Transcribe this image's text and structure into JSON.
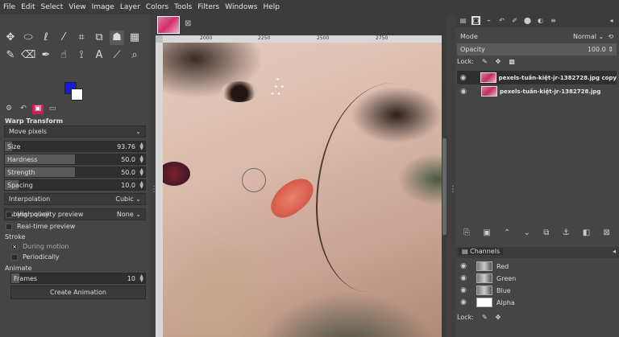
{
  "menu": [
    "File",
    "Edit",
    "Select",
    "View",
    "Image",
    "Layer",
    "Colors",
    "Tools",
    "Filters",
    "Windows",
    "Help"
  ],
  "tool_options": {
    "title": "Warp Transform",
    "behavior": "Move pixels",
    "sliders": [
      {
        "label": "Size",
        "value": "93.76",
        "fraction": 0.05
      },
      {
        "label": "Hardness",
        "value": "50.0",
        "fraction": 0.5
      },
      {
        "label": "Strength",
        "value": "50.0",
        "fraction": 0.5
      },
      {
        "label": "Spacing",
        "value": "10.0",
        "fraction": 0.1
      }
    ],
    "interpolation_label": "Interpolation",
    "interpolation_value": "Cubic",
    "abyss_label": "Abyss policy",
    "abyss_value": "None",
    "high_quality": "High quality preview",
    "realtime": "Real-time preview",
    "stroke_label": "Stroke",
    "during_motion": "During motion",
    "periodically": "Periodically",
    "animate_label": "Animate",
    "frames_label": "Frames",
    "frames_value": "10",
    "create_animation": "Create Animation"
  },
  "ruler": {
    "t1": "2000",
    "t2": "2250",
    "t3": "2500",
    "t4": "2750"
  },
  "layers_panel": {
    "mode_label": "Mode",
    "mode_value": "Normal",
    "opacity_label": "Opacity",
    "opacity_value": "100.0",
    "lock_label": "Lock:",
    "layers": [
      {
        "name": "pexels-tuấn-kiệt-jr-1382728.jpg copy"
      },
      {
        "name": "pexels-tuấn-kiệt-jr-1382728.jpg"
      }
    ]
  },
  "channels_panel": {
    "tab": "Channels",
    "channels": [
      "Red",
      "Green",
      "Blue",
      "Alpha"
    ],
    "lock_label": "Lock:"
  },
  "colors": {
    "foreground": "#1818e0",
    "background": "#ffffff"
  }
}
